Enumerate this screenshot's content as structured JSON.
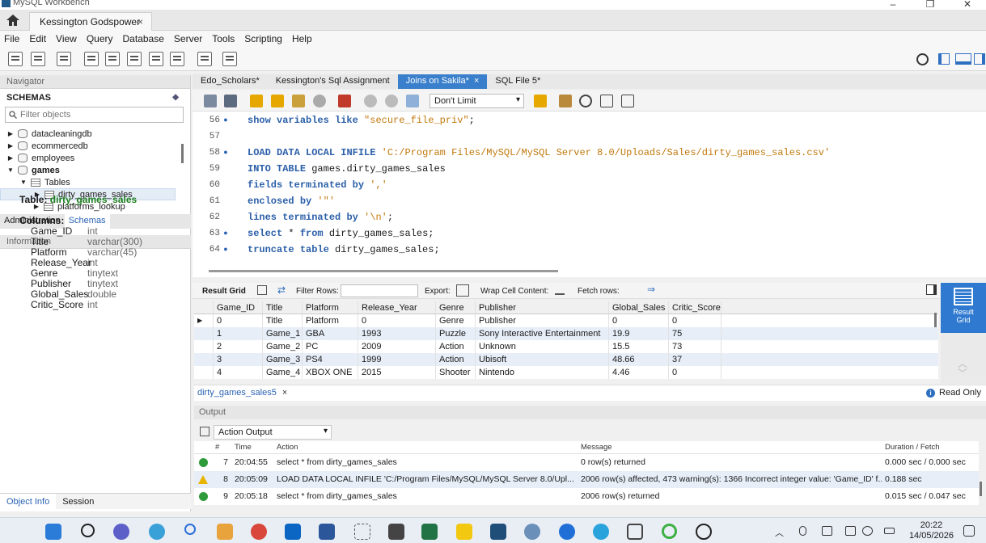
{
  "app": {
    "title": "MySQL Workbench",
    "connection_tab": "Kessington Godspower",
    "tab_close": "×",
    "window_controls": [
      "–",
      "❐",
      "✕"
    ]
  },
  "menu": [
    "File",
    "Edit",
    "View",
    "Query",
    "Database",
    "Server",
    "Tools",
    "Scripting",
    "Help"
  ],
  "navigator": {
    "header": "Navigator",
    "schemas_title": "SCHEMAS",
    "filter_placeholder": "Filter objects",
    "tree": [
      {
        "label": "datacleaningdb",
        "arrow": "▶",
        "kind": "db",
        "indent": 0
      },
      {
        "label": "ecommercedb",
        "arrow": "▶",
        "kind": "db",
        "indent": 0
      },
      {
        "label": "employees",
        "arrow": "▶",
        "kind": "db",
        "indent": 0
      },
      {
        "label": "games",
        "arrow": "▼",
        "kind": "db",
        "indent": 0,
        "bold": true
      },
      {
        "label": "Tables",
        "arrow": "▼",
        "kind": "tables",
        "indent": 1
      },
      {
        "label": "dirty_games_sales",
        "arrow": "▶",
        "kind": "table",
        "indent": 2,
        "selected": true
      },
      {
        "label": "platforms_lookup",
        "arrow": "▶",
        "kind": "table",
        "indent": 2
      }
    ],
    "tabs": [
      "Administration",
      "Schemas"
    ],
    "active_tab": "Schemas"
  },
  "info": {
    "header": "Information",
    "table_label": "Table:",
    "table_name": "dirty_games_sales",
    "columns_label": "Columns:",
    "columns": [
      {
        "name": "Game_ID",
        "type": "int"
      },
      {
        "name": "Title",
        "type": "varchar(300)"
      },
      {
        "name": "Platform",
        "type": "varchar(45)"
      },
      {
        "name": "Release_Year",
        "type": "int"
      },
      {
        "name": "Genre",
        "type": "tinytext"
      },
      {
        "name": "Publisher",
        "type": "tinytext"
      },
      {
        "name": "Global_Sales",
        "type": "double"
      },
      {
        "name": "Critic_Score",
        "type": "int"
      }
    ],
    "bottom_tabs": [
      "Object Info",
      "Session"
    ]
  },
  "sql_tabs": [
    {
      "label": "Edo_Scholars*",
      "active": false
    },
    {
      "label": "Kessington's Sql Assignment",
      "active": false
    },
    {
      "label": "Joins on Sakila*",
      "active": true
    },
    {
      "label": "SQL File 5*",
      "active": false
    }
  ],
  "editor": {
    "limit": "Don't Limit",
    "lines": [
      {
        "num": "56",
        "dot": true,
        "code": "show variables like \"secure_file_priv\";"
      },
      {
        "num": "57",
        "dot": false,
        "code": ""
      },
      {
        "num": "58",
        "dot": true,
        "code": "LOAD DATA LOCAL INFILE 'C:/Program Files/MySQL/MySQL Server 8.0/Uploads/Sales/dirty_games_sales.csv'"
      },
      {
        "num": "59",
        "dot": false,
        "code": "INTO TABLE games.dirty_games_sales"
      },
      {
        "num": "60",
        "dot": false,
        "code": "fields terminated by ','"
      },
      {
        "num": "61",
        "dot": false,
        "code": "enclosed by '\"'"
      },
      {
        "num": "62",
        "dot": false,
        "code": "lines terminated by '\\n';"
      },
      {
        "num": "63",
        "dot": true,
        "code": "select * from dirty_games_sales;"
      },
      {
        "num": "64",
        "dot": true,
        "code": "truncate table dirty_games_sales;"
      }
    ]
  },
  "result_toolbar": {
    "result_grid": "Result Grid",
    "filter_rows": "Filter Rows:",
    "export": "Export:",
    "wrap": "Wrap Cell Content:",
    "fetch": "Fetch rows:"
  },
  "grid": {
    "columns": [
      "Game_ID",
      "Title",
      "Platform",
      "Release_Year",
      "Genre",
      "Publisher",
      "Global_Sales",
      "Critic_Score"
    ],
    "rows": [
      [
        "0",
        "Title",
        "Platform",
        "0",
        "Genre",
        "Publisher",
        "0",
        "0"
      ],
      [
        "1",
        "Game_1",
        "GBA",
        "1993",
        "Puzzle",
        "Sony Interactive Entertainment",
        "19.9",
        "75"
      ],
      [
        "2",
        "Game_2",
        "PC",
        "2009",
        "Action",
        "Unknown",
        "15.5",
        "73"
      ],
      [
        "3",
        "Game_3",
        "PS4",
        "1999",
        "Action",
        "Ubisoft",
        "48.66",
        "37"
      ],
      [
        "4",
        "Game_4",
        "XBOX ONE",
        "2015",
        "Shooter",
        "Nintendo",
        "4.46",
        "0"
      ]
    ],
    "row_marker": "▶"
  },
  "result_side": {
    "label_line1": "Result",
    "label_line2": "Grid"
  },
  "result_tab": {
    "label": "dirty_games_sales5",
    "close": "×",
    "read_only": "Read Only",
    "info_glyph": "i"
  },
  "output": {
    "header": "Output",
    "selector": "Action Output",
    "columns": [
      "#",
      "Time",
      "Action",
      "Message",
      "Duration / Fetch"
    ],
    "rows": [
      {
        "status": "ok",
        "num": "7",
        "time": "20:04:55",
        "action": "select * from dirty_games_sales",
        "message": "0 row(s) returned",
        "duration": "0.000 sec / 0.000 sec"
      },
      {
        "status": "warn",
        "num": "8",
        "time": "20:05:09",
        "action": "LOAD DATA LOCAL INFILE 'C:/Program Files/MySQL/MySQL Server 8.0/Upl...",
        "message": "2006 row(s) affected, 473 warning(s): 1366 Incorrect integer value: 'Game_ID' f...",
        "duration": "0.188 sec"
      },
      {
        "status": "ok",
        "num": "9",
        "time": "20:05:18",
        "action": "select * from dirty_games_sales",
        "message": "2006 row(s) returned",
        "duration": "0.015 sec / 0.047 sec"
      }
    ]
  },
  "taskbar": {
    "time": "20:22",
    "date": "14/05/2026"
  }
}
